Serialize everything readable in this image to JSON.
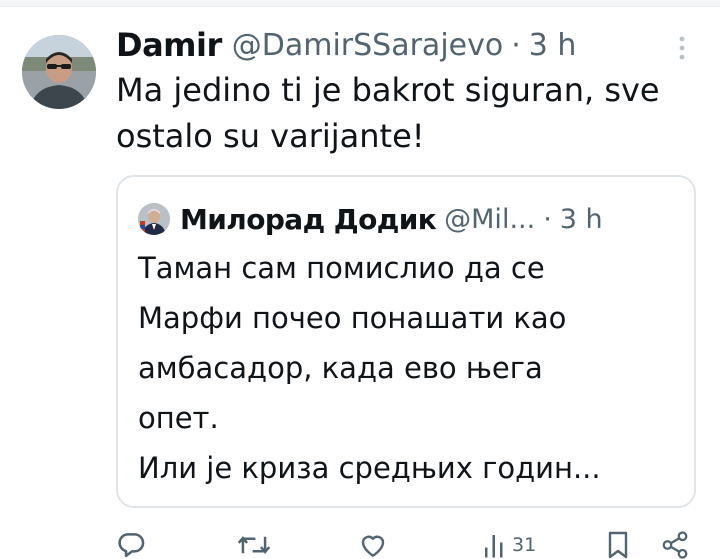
{
  "tweet": {
    "author_name": "Damir",
    "author_handle": "@DamirSSarajevo",
    "separator": "·",
    "time": "3 h",
    "text": "Ma jedino ti je bakrot siguran, sve ostalo su varijante!"
  },
  "quote": {
    "author_name": "Милорад Додик",
    "author_handle": "@Mil...",
    "separator": "·",
    "time": "3 h",
    "lines": [
      "Таман сам помислио да се",
      "Марфи почео понашати као",
      "амбасадор, када ево њега",
      "опет.",
      "Или је криза средњих годин..."
    ]
  },
  "actions": {
    "reply_icon": "reply-icon",
    "retweet_icon": "retweet-icon",
    "like_icon": "heart-icon",
    "views_icon": "views-icon",
    "views_count": "31",
    "bookmark_icon": "bookmark-icon",
    "share_icon": "share-icon"
  },
  "colors": {
    "text_primary": "#0f1419",
    "text_secondary": "#536471",
    "border": "#dfe4e8"
  }
}
